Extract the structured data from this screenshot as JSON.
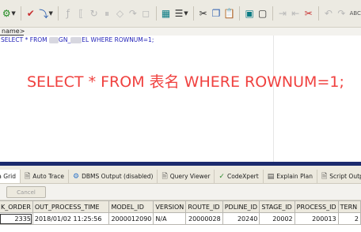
{
  "toolbar": {
    "icons": [
      "settings-gear-icon",
      "check-run-icon",
      "step-icon",
      "function-icon",
      "bracket-icon",
      "loop-icon",
      "dim-a",
      "dim-b",
      "dim-c",
      "dim-d",
      "grid-icon",
      "list-icon",
      "cut-icon",
      "copy-icon",
      "paste-icon",
      "select-icon",
      "new-doc-icon",
      "arrow-a",
      "arrow-b",
      "scissors-icon",
      "undo-icon",
      "redo-icon"
    ],
    "trailing_text": "ABC"
  },
  "namebar": {
    "label": "name>"
  },
  "editor": {
    "sql_prefix": "SELECT * FROM ",
    "sql_table_fragment_1": "GN_",
    "sql_table_fragment_2": "EL",
    "sql_suffix": " WHERE ROWNUM=1;",
    "big_statement": "SELECT * FROM 表名 WHERE ROWNUM=1;"
  },
  "tabs": [
    {
      "label": "Data Grid",
      "icon": "grid-icon",
      "active": true
    },
    {
      "label": "Auto Trace",
      "icon": "document-icon",
      "active": false
    },
    {
      "label": "DBMS Output (disabled)",
      "icon": "dbms-icon",
      "active": false
    },
    {
      "label": "Query Viewer",
      "icon": "document-icon",
      "active": false
    },
    {
      "label": "CodeXpert",
      "icon": "codexpert-icon",
      "active": false
    },
    {
      "label": "Explain Plan",
      "icon": "explain-icon",
      "active": false
    },
    {
      "label": "Script Output",
      "icon": "document-icon",
      "active": false
    }
  ],
  "cancel_label": "Cancel",
  "grid": {
    "columns": [
      "K_ORDER",
      "OUT_PROCESS_TIME",
      "MODEL_ID",
      "VERSION",
      "ROUTE_ID",
      "PDLINE_ID",
      "STAGE_ID",
      "PROCESS_ID",
      "TERN"
    ],
    "rows": [
      [
        "2335",
        "2018/01/02 11:25:56",
        "2000012090",
        "N/A",
        "20000028",
        "20240",
        "20002",
        "200013",
        "2"
      ]
    ]
  },
  "colors": {
    "sql_text": "#1f1fb7",
    "big_text": "#f0413f",
    "splitter": "#1a2a6e"
  }
}
